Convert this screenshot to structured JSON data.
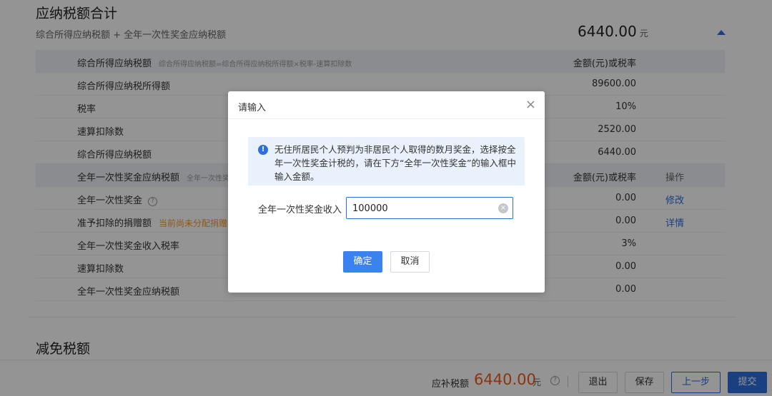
{
  "section": {
    "title": "应纳税额合计",
    "subtitle": "综合所得应纳税额 + 全年一次性奖金应纳税额",
    "total_value": "6440.00",
    "total_unit": "元"
  },
  "table": {
    "group1": {
      "header_label": "综合所得应纳税额",
      "header_hint": "综合所得应纳税额=综合所得应纳税所得额×税率-速算扣除数",
      "header_value": "金额(元)或税率",
      "rows": [
        {
          "label": "综合所得应纳税所得额",
          "value": "89600.00"
        },
        {
          "label": "税率",
          "value": "10%"
        },
        {
          "label": "速算扣除数",
          "value": "2520.00"
        },
        {
          "label": "综合所得应纳税额",
          "value": "6440.00"
        }
      ]
    },
    "group2": {
      "header_label": "全年一次性奖金应纳税额",
      "header_hint": "全年一次性奖",
      "header_value": "金额(元)或税率",
      "header_action": "操作",
      "rows": [
        {
          "label": "全年一次性奖金",
          "value": "0.00",
          "action": "修改",
          "help": "?"
        },
        {
          "label": "准予扣除的捐赠额",
          "warn": "当前尚未分配捐赠",
          "value": "0.00",
          "action": "详情"
        },
        {
          "label": "全年一次性奖金收入税率",
          "value": "3%"
        },
        {
          "label": "速算扣除数",
          "value": "0.00"
        },
        {
          "label": "全年一次性奖金应纳税额",
          "value": "0.00"
        }
      ]
    }
  },
  "section2": {
    "title": "减免税额"
  },
  "footer": {
    "label": "应补税额",
    "amount": "6440.00",
    "unit": "元",
    "help": "?",
    "buttons": {
      "exit": "退出",
      "save": "保存",
      "prev": "上一步",
      "submit": "提交"
    }
  },
  "dialog": {
    "title": "请输入",
    "close": "×",
    "notice_icon": "!",
    "notice": "无住所居民个人预判为非居民个人取得的数月奖金，选择按全年一次性奖金计税的，请在下方“全年一次性奖金”的输入框中输入金额。",
    "field_label": "全年一次性奖金收入",
    "field_value": "100000",
    "clear_icon": "×",
    "ok": "确定",
    "cancel": "取消"
  },
  "colors": {
    "accent": "#2d6ee0",
    "amount": "#f05a1a",
    "warn": "#f59a23"
  }
}
